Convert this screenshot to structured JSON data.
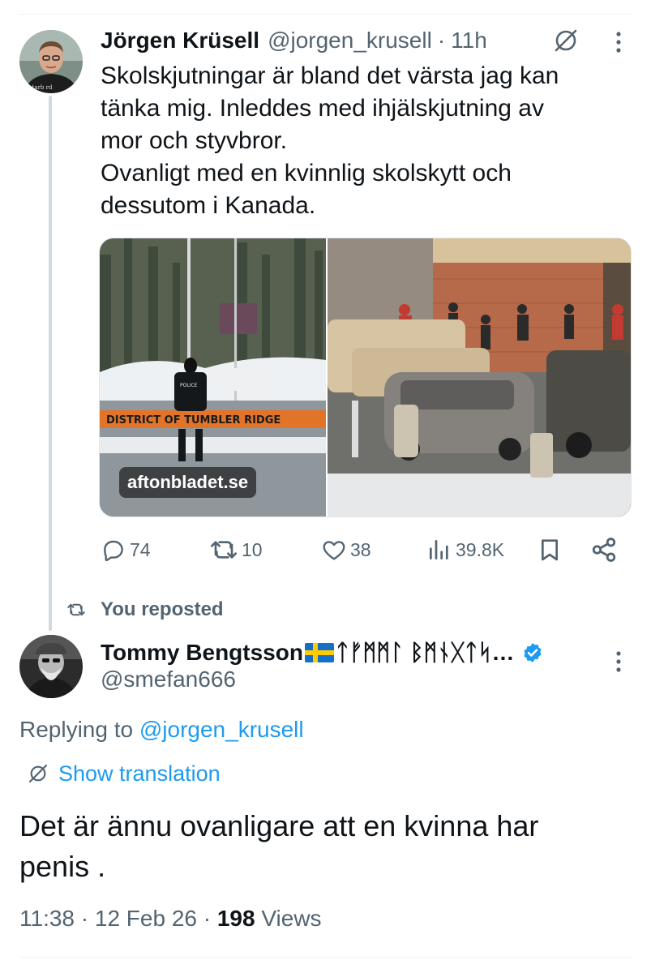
{
  "tweet1": {
    "author_name": "Jörgen Krüsell",
    "handle": "@jorgen_krusell",
    "separator": "·",
    "time": "11h",
    "text_lines": [
      "Skolskjutningar är bland det värsta jag kan",
      "tänka mig. Inleddes med ihjälskjutning av",
      "mor och styvbror.",
      "Ovanligt med en kvinnlig skolskytt och",
      "dessutom i Kanada."
    ],
    "media": {
      "left_sign_text": "DISTRICT OF TUMBLER RIDGE",
      "source_label": "aftonbladet.se",
      "vest_text": "POLICE"
    },
    "actions": {
      "replies": "74",
      "reposts": "10",
      "likes": "38",
      "views": "39.8K"
    }
  },
  "repost_context": {
    "label": "You reposted"
  },
  "tweet2": {
    "author_name": "Tommy Bengtsson",
    "name_suffix": "ᛏᚠᛗᛗᛚ ᛒᛗᚾᚷᛏᛋ…",
    "handle": "@smefan666",
    "replying_prefix": "Replying to",
    "replying_to": "@jorgen_krusell",
    "show_translation": "Show translation",
    "text_lines": [
      "Det är ännu ovanligare att en kvinna har",
      "penis ."
    ],
    "meta": {
      "time_date": "11:38 · 12 Feb 26 ·",
      "views_count": "198",
      "views_label": "Views"
    }
  },
  "colors": {
    "accent": "#1d9bf0",
    "text_primary": "#0f1419",
    "text_secondary": "#536471"
  },
  "icons": [
    "reply-icon",
    "repost-icon",
    "like-icon",
    "views-icon",
    "bookmark-icon",
    "share-icon",
    "grok-icon",
    "more-icon",
    "verified-icon",
    "translate-icon"
  ]
}
